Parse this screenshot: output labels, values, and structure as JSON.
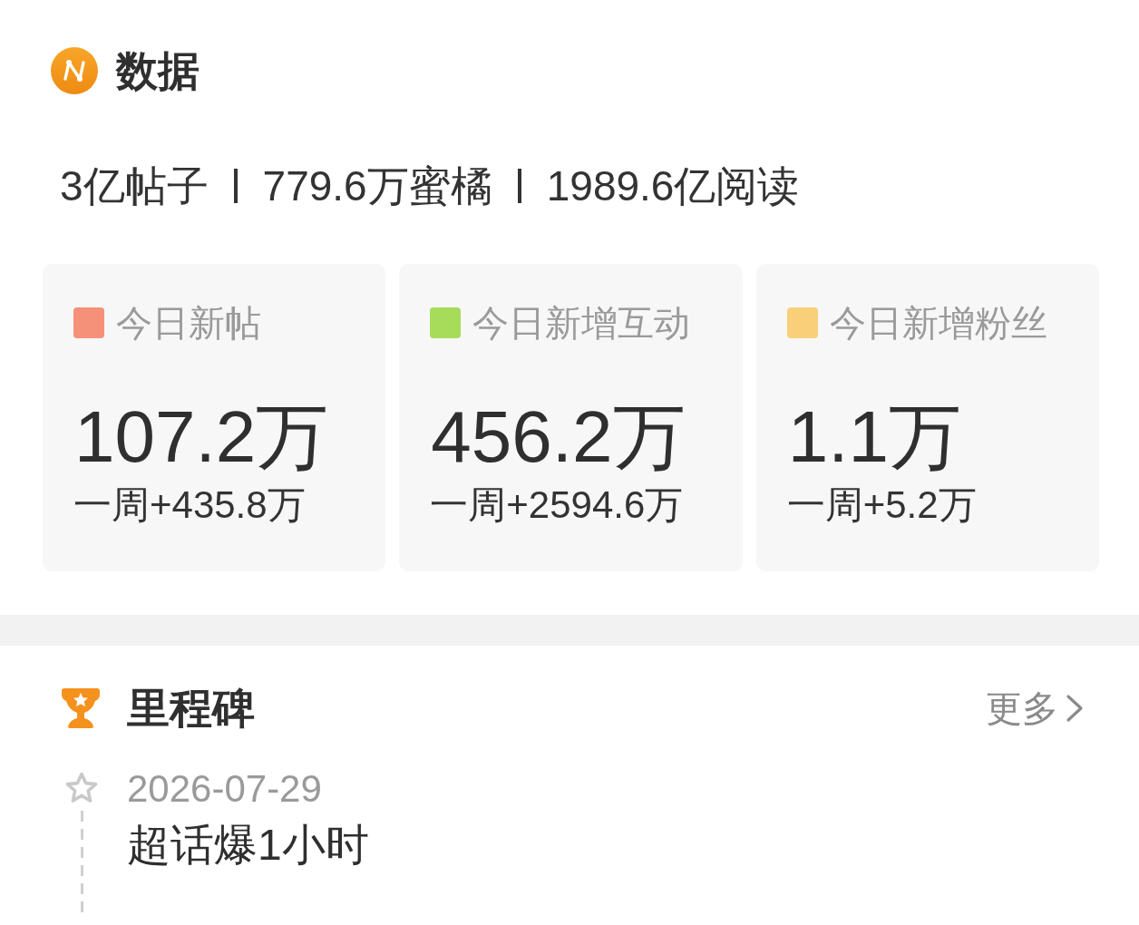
{
  "data_section": {
    "title": "数据",
    "summary": [
      "3亿帖子",
      "779.6万蜜橘",
      "1989.6亿阅读"
    ],
    "cards": [
      {
        "label": "今日新帖",
        "color": "#f59079",
        "value": "107.2万",
        "week": "一周+435.8万"
      },
      {
        "label": "今日新增互动",
        "color": "#a6dc5a",
        "value": "456.2万",
        "week": "一周+2594.6万"
      },
      {
        "label": "今日新增粉丝",
        "color": "#f9cf7a",
        "value": "1.1万",
        "week": "一周+5.2万"
      }
    ]
  },
  "milestones": {
    "title": "里程碑",
    "more": "更多",
    "items": [
      {
        "date": "2026-07-29",
        "text": "超话爆1小时"
      }
    ]
  }
}
